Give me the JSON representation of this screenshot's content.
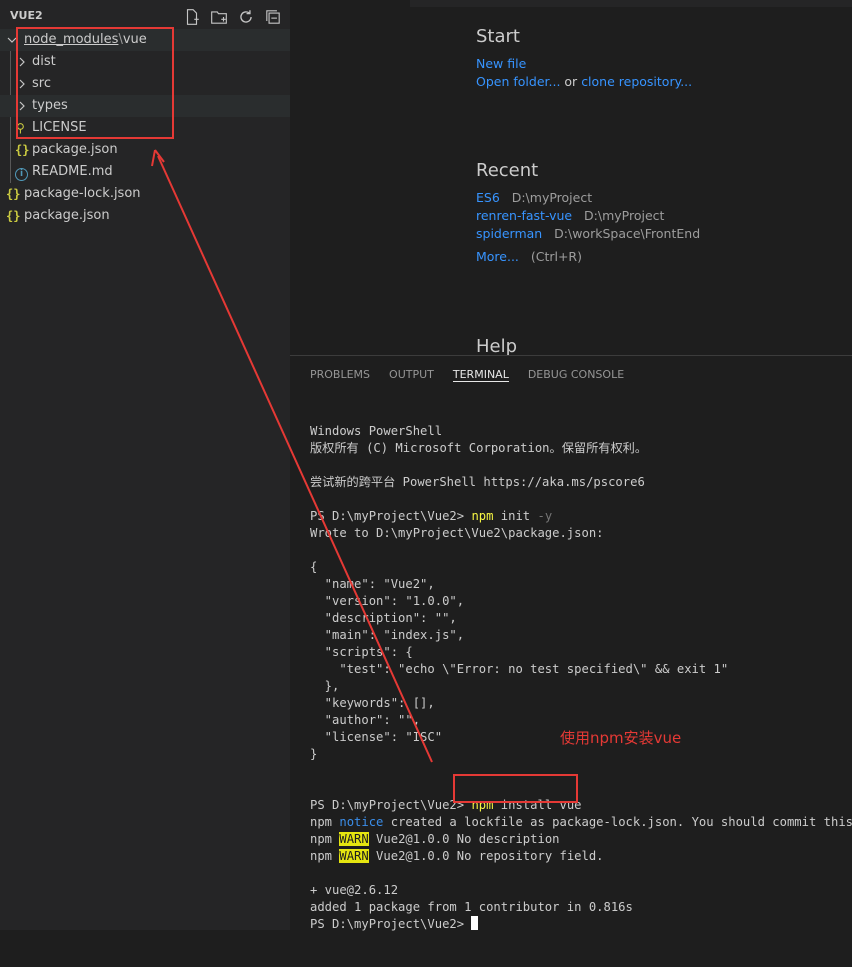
{
  "explorer": {
    "title": "VUE2",
    "actions": [
      "new-file-icon",
      "new-folder-icon",
      "refresh-icon",
      "collapse-all-icon"
    ],
    "tree": [
      {
        "label": "node_modules",
        "sep": "\\",
        "suffix": "vue",
        "type": "folder-open"
      },
      {
        "label": "dist",
        "type": "folder"
      },
      {
        "label": "src",
        "type": "folder"
      },
      {
        "label": "types",
        "type": "folder"
      },
      {
        "label": "LICENSE",
        "type": "license"
      },
      {
        "label": "package.json",
        "type": "json"
      },
      {
        "label": "README.md",
        "type": "info"
      },
      {
        "label": "package-lock.json",
        "type": "json"
      },
      {
        "label": "package.json",
        "type": "json"
      }
    ]
  },
  "welcome": {
    "start_heading": "Start",
    "new_file": "New file",
    "open_folder": "Open folder...",
    "or_text": "or",
    "clone_repo": "clone repository...",
    "recent_heading": "Recent",
    "recent": [
      {
        "name": "ES6",
        "path": "D:\\myProject"
      },
      {
        "name": "renren-fast-vue",
        "path": "D:\\myProject"
      },
      {
        "name": "spiderman",
        "path": "D:\\workSpace\\FrontEnd"
      }
    ],
    "more": "More...",
    "more_shortcut": "(Ctrl+R)",
    "help_heading": "Help"
  },
  "panel": {
    "tabs": [
      "PROBLEMS",
      "OUTPUT",
      "TERMINAL",
      "DEBUG CONSOLE"
    ],
    "active_tab": "TERMINAL"
  },
  "terminal": {
    "l1": "Windows PowerShell",
    "l2": "版权所有 (C) Microsoft Corporation。保留所有权利。",
    "l3": "尝试新的跨平台 PowerShell https://aka.ms/pscore6",
    "prompt": "PS D:\\myProject\\Vue2> ",
    "cmd1_npm": "npm",
    "cmd1_rest": " init ",
    "cmd1_flag": "-y",
    "wrote": "Wrote to D:\\myProject\\Vue2\\package.json:",
    "json": [
      "{",
      "  \"name\": \"Vue2\",",
      "  \"version\": \"1.0.0\",",
      "  \"description\": \"\",",
      "  \"main\": \"index.js\",",
      "  \"scripts\": {",
      "    \"test\": \"echo \\\"Error: no test specified\\\" && exit 1\"",
      "  },",
      "  \"keywords\": [],",
      "  \"author\": \"\",",
      "  \"license\": \"ISC\"",
      "}"
    ],
    "cmd2_npm": "npm",
    "cmd2_rest": " install vue",
    "npm_word": "npm",
    "notice_word": "notice",
    "notice_text": " created a lockfile as package-lock.json. You should commit this fil",
    "warn_word": "WARN",
    "warn1": " Vue2@1.0.0 No description",
    "warn2": " Vue2@1.0.0 No repository field.",
    "plus": "+ vue@2.6.12",
    "added": "added 1 package from 1 contributor in 0.816s",
    "final_prompt": "PS D:\\myProject\\Vue2> "
  },
  "annotation": {
    "text": "使用npm安装vue",
    "color": "#e53935"
  }
}
